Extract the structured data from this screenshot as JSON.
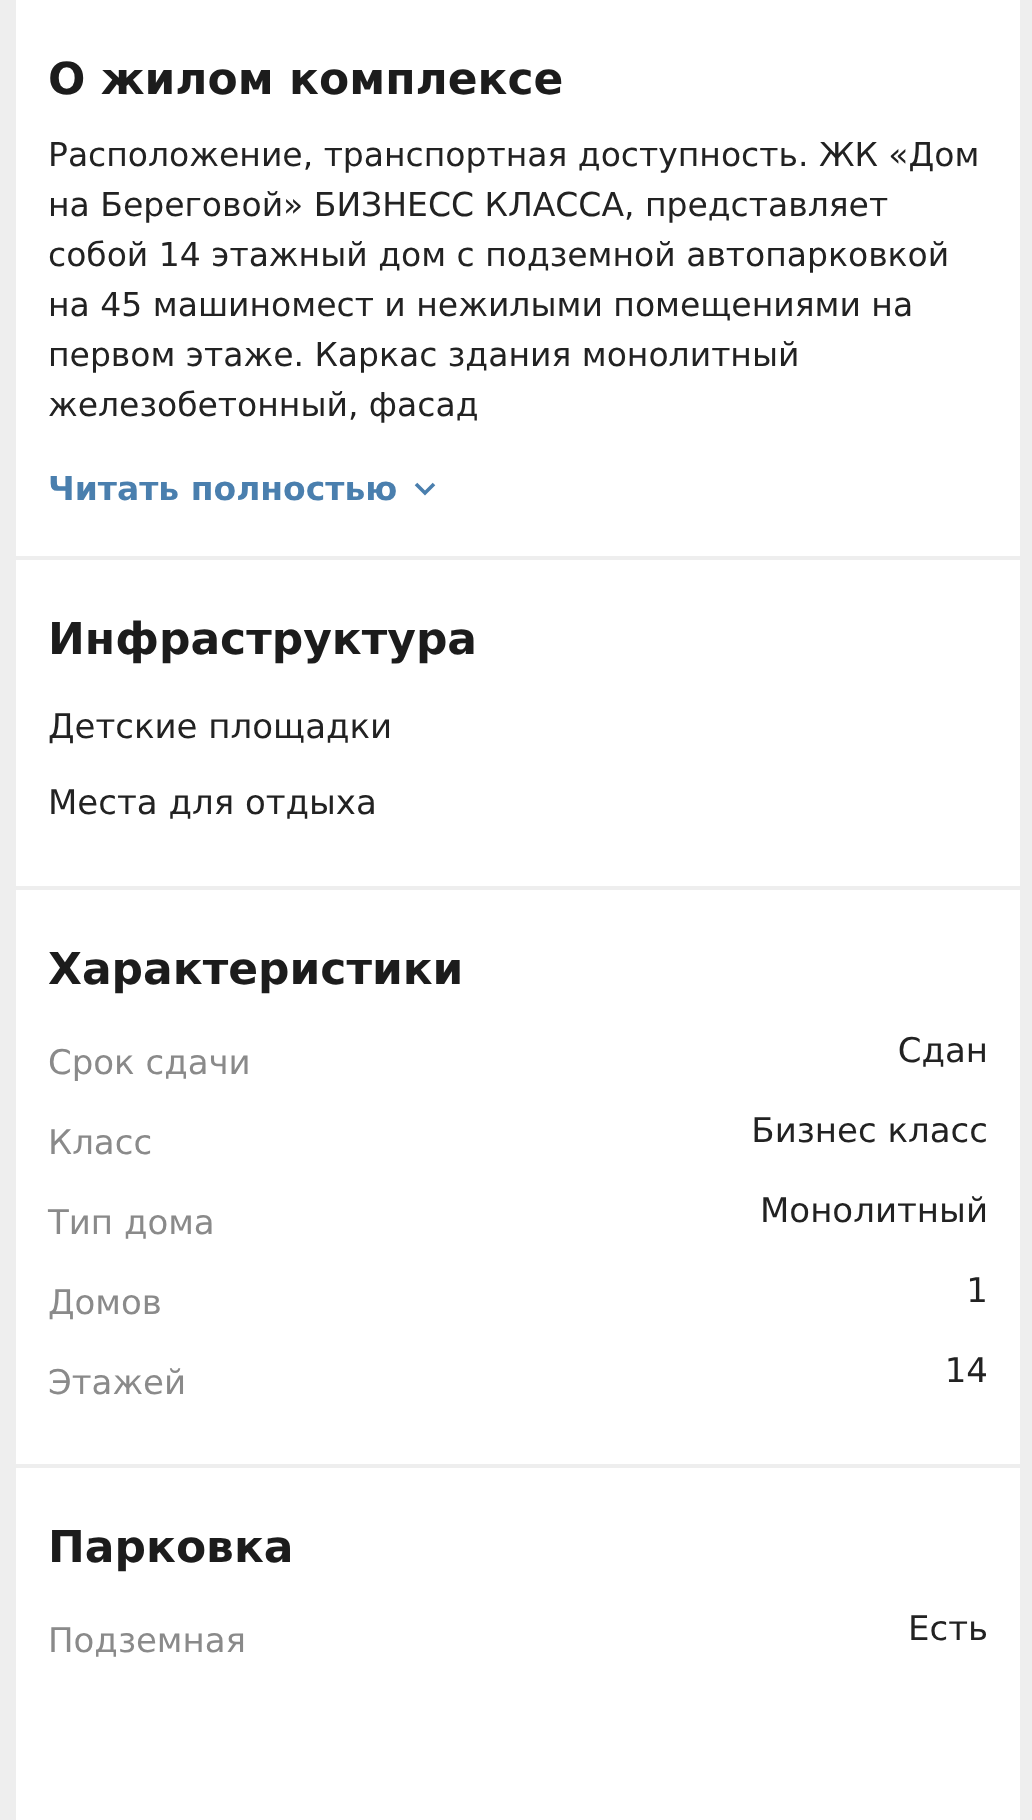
{
  "about": {
    "title": "О жилом комплексе",
    "text": "Расположение, транспортная доступность. ЖК «Дом на Береговой» БИЗНЕСС КЛАССА, представляет собой 14 этажный дом с подземной автопарковкой на 45 машиномест и нежилыми помещениями на первом этаже. Каркас здания монолитный железобетонный, фасад",
    "read_more": "Читать полностью"
  },
  "infrastructure": {
    "title": "Инфраструктура",
    "items": [
      "Детские площадки",
      "Места для отдыха"
    ]
  },
  "characteristics": {
    "title": "Характеристики",
    "rows": [
      {
        "label": "Срок сдачи",
        "value": "Сдан"
      },
      {
        "label": "Класс",
        "value": "Бизнес класс"
      },
      {
        "label": "Тип дома",
        "value": "Монолитный"
      },
      {
        "label": "Домов",
        "value": "1"
      },
      {
        "label": "Этажей",
        "value": "14"
      }
    ]
  },
  "parking": {
    "title": "Парковка",
    "rows": [
      {
        "label": "Подземная",
        "value": "Есть"
      }
    ]
  }
}
